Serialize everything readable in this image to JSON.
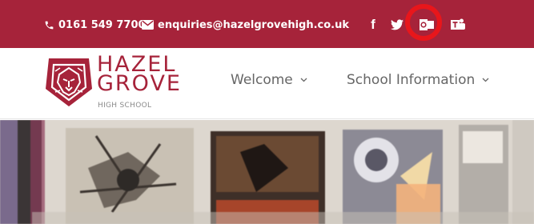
{
  "contact": {
    "phone": "0161 549 7700",
    "email": "enquiries@hazelgrovehigh.co.uk",
    "phone_icon": "phone-icon",
    "email_icon": "envelope-icon"
  },
  "social": [
    {
      "name": "facebook-icon",
      "label": "f"
    },
    {
      "name": "twitter-icon"
    },
    {
      "name": "outlook-icon"
    },
    {
      "name": "teams-icon"
    }
  ],
  "highlight": {
    "color": "#e8161b",
    "target": "outlook-icon"
  },
  "brand": {
    "line1": "HAZEL",
    "line2": "GROVE",
    "sub": "HIGH SCHOOL",
    "color": "#a6233a"
  },
  "nav": [
    {
      "label": "Welcome",
      "icon": "chevron-down-icon"
    },
    {
      "label": "School Information",
      "icon": "chevron-down-icon"
    }
  ],
  "colors": {
    "topbar": "#a6233a",
    "nav_text": "#666666"
  }
}
